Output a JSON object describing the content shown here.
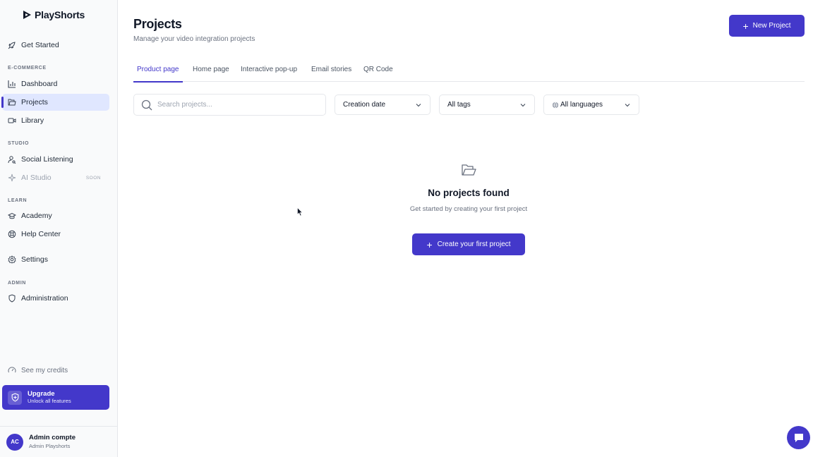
{
  "brand": {
    "name": "PlayShorts"
  },
  "sidebar": {
    "get_started": "Get Started",
    "sections": {
      "ecommerce": "E-COMMERCE",
      "studio": "STUDIO",
      "learn": "LEARN",
      "admin": "ADMIN"
    },
    "items": {
      "dashboard": "Dashboard",
      "projects": "Projects",
      "library": "Library",
      "social_listening": "Social Listening",
      "ai_studio": "AI Studio",
      "ai_studio_badge": "SOON",
      "academy": "Academy",
      "help_center": "Help Center",
      "settings": "Settings",
      "administration": "Administration"
    },
    "credits": "See my credits",
    "upgrade": {
      "title": "Upgrade",
      "subtitle": "Unlock all features"
    },
    "user": {
      "initials": "AC",
      "name": "Admin compte",
      "org": "Admin Playshorts"
    }
  },
  "header": {
    "title": "Projects",
    "subtitle": "Manage your video integration projects",
    "new_button": "New Project"
  },
  "tabs": [
    {
      "label": "Product page",
      "active": true
    },
    {
      "label": "Home page",
      "active": false
    },
    {
      "label": "Interactive pop-up",
      "active": false
    },
    {
      "label": "Email stories",
      "active": false
    },
    {
      "label": "QR Code",
      "active": false
    }
  ],
  "filters": {
    "search_placeholder": "Search projects...",
    "sort": "Creation date",
    "tags": "All tags",
    "languages": "All languages"
  },
  "empty_state": {
    "title": "No projects found",
    "subtitle": "Get started by creating your first project",
    "button": "Create your first project"
  },
  "colors": {
    "accent": "#4338ca",
    "active_bg": "#e0e7ff"
  },
  "icons": {
    "get_started": "rocket-icon",
    "dashboard": "bar-chart-icon",
    "projects": "folder-icon",
    "library": "video-icon",
    "social_listening": "user-search-icon",
    "ai_studio": "sparkle-icon",
    "academy": "graduation-cap-icon",
    "help_center": "lifebuoy-icon",
    "settings": "gear-icon",
    "administration": "shield-icon",
    "credits": "gauge-icon",
    "upgrade": "shield-plus-icon",
    "empty_state": "folder-open-icon",
    "chat": "chat-icon"
  }
}
